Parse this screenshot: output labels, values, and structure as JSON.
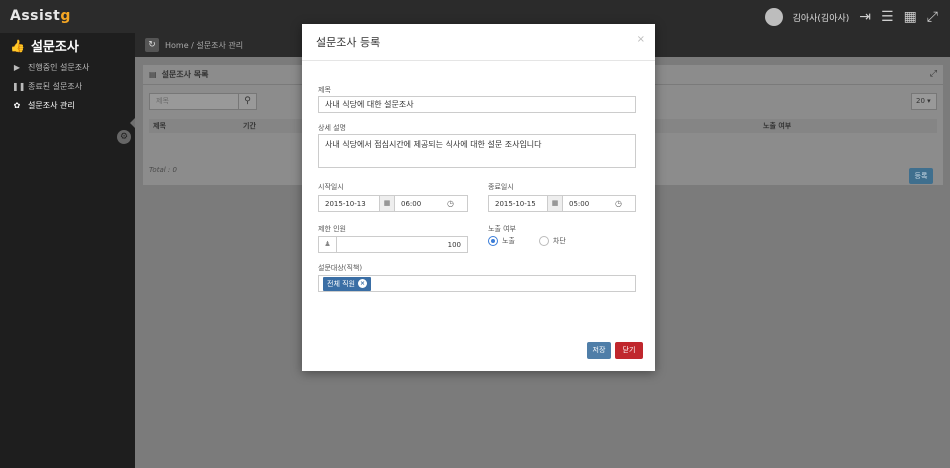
{
  "app": {
    "logo_main": "Assist",
    "logo_accent": "g"
  },
  "topbar": {
    "user_name": "김아사(김아사)",
    "icons": [
      "logout-icon",
      "menu-icon",
      "grid-icon",
      "fullscreen-icon"
    ]
  },
  "sidebar": {
    "title": "설문조사",
    "items": [
      {
        "label": "진행중인 설문조사",
        "icon": "play-icon"
      },
      {
        "label": "종료된 설문조사",
        "icon": "pause-icon"
      },
      {
        "label": "설문조사 관리",
        "icon": "gear-icon"
      }
    ]
  },
  "breadcrumb": {
    "text": "Home / 설문조사 관리"
  },
  "list_panel": {
    "title": "설문조사 목록",
    "search_placeholder": "제목",
    "page_size": "20",
    "columns": [
      "제목",
      "기간",
      "노출 여부"
    ],
    "total_text": "Total : 0",
    "register_label": "등록"
  },
  "modal": {
    "title": "설문조사 등록",
    "close_glyph": "×",
    "fields": {
      "title_label": "제목",
      "title_value": "사내 식당에 대한 설문조사",
      "desc_label": "상세 설명",
      "desc_value": "사내 식당에서 점심시간에 제공되는 식사에 대한 설문 조사입니다",
      "start_label": "시작일시",
      "start_date": "2015-10-13",
      "start_time": "06:00",
      "end_label": "종료일시",
      "end_date": "2015-10-15",
      "end_time": "05:00",
      "limit_label": "제한 인원",
      "limit_value": "100",
      "visibility_label": "노출 여부",
      "visibility_options": [
        "노출",
        "차단"
      ],
      "visibility_selected": "노출",
      "target_label": "설문대상(직책)",
      "target_tag": "전체 직원"
    },
    "buttons": {
      "save": "저장",
      "close": "닫기"
    }
  },
  "colors": {
    "primary": "#4f7ea8",
    "danger": "#c0272d",
    "tag": "#3a6ea5",
    "radio": "#3b7dd8"
  }
}
